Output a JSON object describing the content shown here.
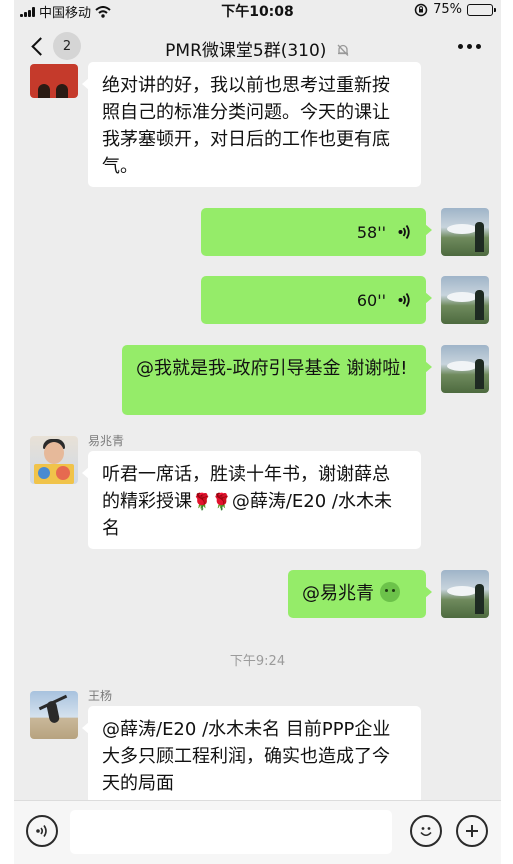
{
  "status": {
    "carrier": "中国移动",
    "time": "下午10:08",
    "battery": "75%",
    "battery_level": 0.75
  },
  "header": {
    "back_count": "2",
    "title": "PMR微课堂5群(310)",
    "icons": {
      "back": "chevron-left-icon",
      "mute": "mute-bell-icon",
      "more": "more-icon"
    }
  },
  "messages": {
    "m1_text": "绝对讲的好，我以前也思考过重新按照自己的标准分类问题。今天的课让我茅塞顿开，对日后的工作也更有底气。",
    "v1_duration": "58''",
    "v2_duration": "60''",
    "m3_text": "@我就是我-政府引导基金 谢谢啦!",
    "yi_name": "易兆青",
    "m4_text_a": "听君一席话，胜读十年书，谢谢薛总的精彩授课",
    "m4_rose": "🌹🌹",
    "m4_text_b": "@薛涛/E20 /水木未名",
    "m5_text": "@易兆青",
    "m5_emoji": "green-face-emoji",
    "time_divider": "下午9:24",
    "wang_name": "王杨",
    "m6_text": "@薛涛/E20 /水木未名 目前PPP企业大多只顾工程利润，确实也造成了今天的局面"
  },
  "input": {
    "value": "",
    "icons": {
      "voice": "voice-icon",
      "emoji": "emoji-icon",
      "plus": "plus-icon"
    }
  }
}
